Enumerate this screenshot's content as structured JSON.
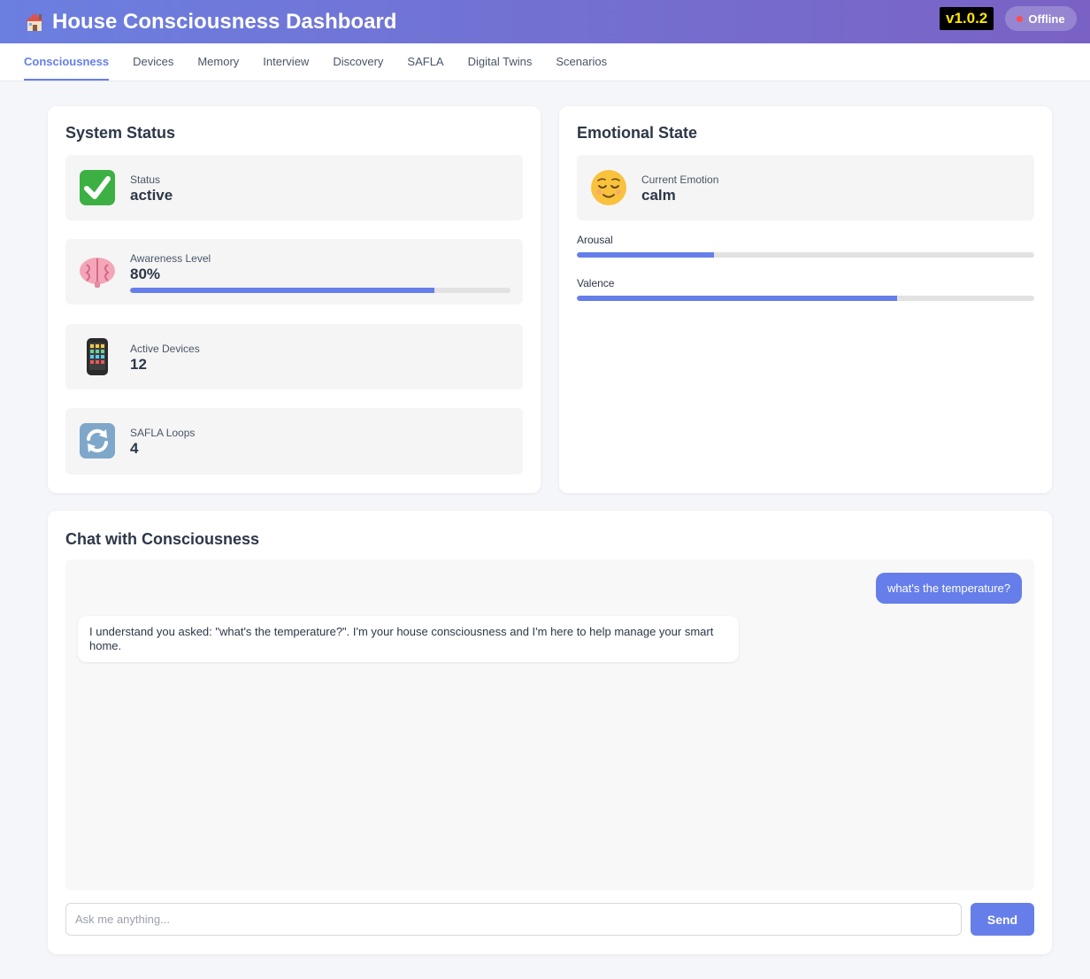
{
  "header": {
    "title": "House Consciousness Dashboard",
    "version": "v1.0.2",
    "connection_status": "Offline",
    "house_icon": "house-icon",
    "status_color": "#ff4d4f"
  },
  "tabs": [
    {
      "label": "Consciousness",
      "active": true
    },
    {
      "label": "Devices",
      "active": false
    },
    {
      "label": "Memory",
      "active": false
    },
    {
      "label": "Interview",
      "active": false
    },
    {
      "label": "Discovery",
      "active": false
    },
    {
      "label": "SAFLA",
      "active": false
    },
    {
      "label": "Digital Twins",
      "active": false
    },
    {
      "label": "Scenarios",
      "active": false
    }
  ],
  "system_status": {
    "title": "System Status",
    "items": [
      {
        "label": "Status",
        "value": "active",
        "icon": "check-icon"
      },
      {
        "label": "Awareness Level",
        "value": "80%",
        "icon": "brain-icon",
        "progress": 0.8
      },
      {
        "label": "Active Devices",
        "value": "12",
        "icon": "phone-icon"
      },
      {
        "label": "SAFLA Loops",
        "value": "4",
        "icon": "refresh-icon"
      }
    ]
  },
  "emotional_state": {
    "title": "Emotional State",
    "current_label": "Current Emotion",
    "current_value": "calm",
    "icon": "relieved-face-icon",
    "arousal": {
      "label": "Arousal",
      "value": 0.3
    },
    "valence": {
      "label": "Valence",
      "value": 0.7
    }
  },
  "chat": {
    "title": "Chat with Consciousness",
    "messages": [
      {
        "role": "user",
        "text": "what's the temperature?"
      },
      {
        "role": "assistant",
        "text": "I understand you asked: \"what's the temperature?\". I'm your house consciousness and I'm here to help manage your smart home."
      }
    ],
    "input_placeholder": "Ask me anything...",
    "input_value": "",
    "send_label": "Send"
  },
  "colors": {
    "accent": "#667eea",
    "header_start": "#6b7fe0",
    "header_end": "#7a62c4"
  }
}
